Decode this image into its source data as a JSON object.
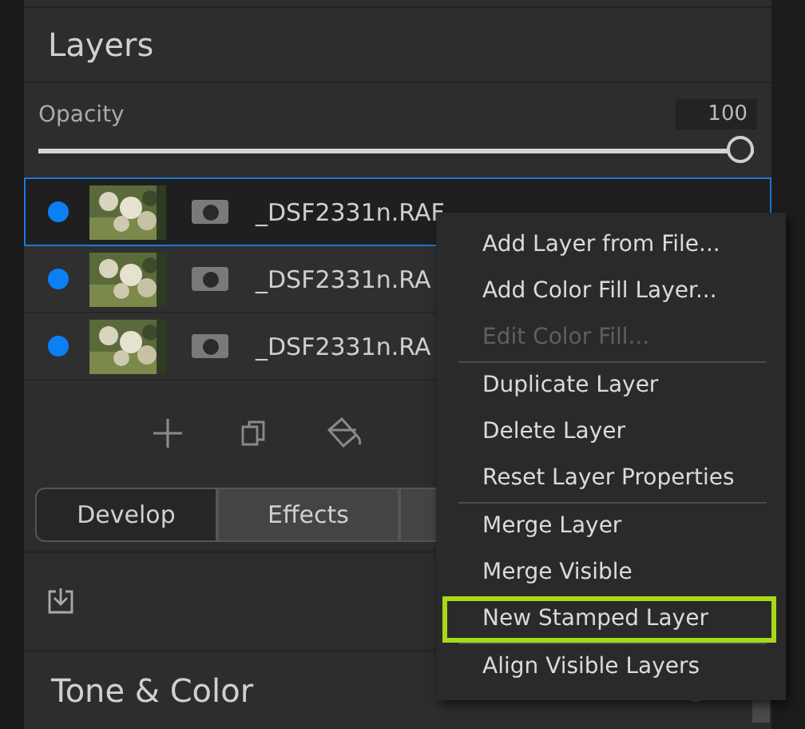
{
  "panel": {
    "title": "Layers"
  },
  "opacity": {
    "label": "Opacity",
    "value": "100",
    "level": 1
  },
  "layers": [
    {
      "name": "_DSF2331n.RAF",
      "selected": true,
      "visible": true
    },
    {
      "name": "_DSF2331n.RA",
      "selected": false,
      "visible": true
    },
    {
      "name": "_DSF2331n.RA",
      "selected": false,
      "visible": true
    }
  ],
  "tabs": [
    {
      "label": "Develop",
      "selected": true
    },
    {
      "label": "Effects",
      "selected": false
    }
  ],
  "section": {
    "title": "Tone & Color"
  },
  "context_menu": [
    {
      "label": "Add Layer from File...",
      "disabled": false,
      "highlighted": false,
      "separator_before": false
    },
    {
      "label": "Add Color Fill Layer...",
      "disabled": false,
      "highlighted": false,
      "separator_before": false
    },
    {
      "label": "Edit Color Fill...",
      "disabled": true,
      "highlighted": false,
      "separator_before": false
    },
    {
      "label": "Duplicate Layer",
      "disabled": false,
      "highlighted": false,
      "separator_before": true
    },
    {
      "label": "Delete Layer",
      "disabled": false,
      "highlighted": false,
      "separator_before": false
    },
    {
      "label": "Reset Layer Properties",
      "disabled": false,
      "highlighted": false,
      "separator_before": false
    },
    {
      "label": "Merge Layer",
      "disabled": false,
      "highlighted": false,
      "separator_before": true
    },
    {
      "label": "Merge Visible",
      "disabled": false,
      "highlighted": false,
      "separator_before": false
    },
    {
      "label": "New Stamped Layer",
      "disabled": false,
      "highlighted": true,
      "separator_before": false
    },
    {
      "label": "Align Visible Layers",
      "disabled": false,
      "highlighted": false,
      "separator_before": true
    }
  ]
}
